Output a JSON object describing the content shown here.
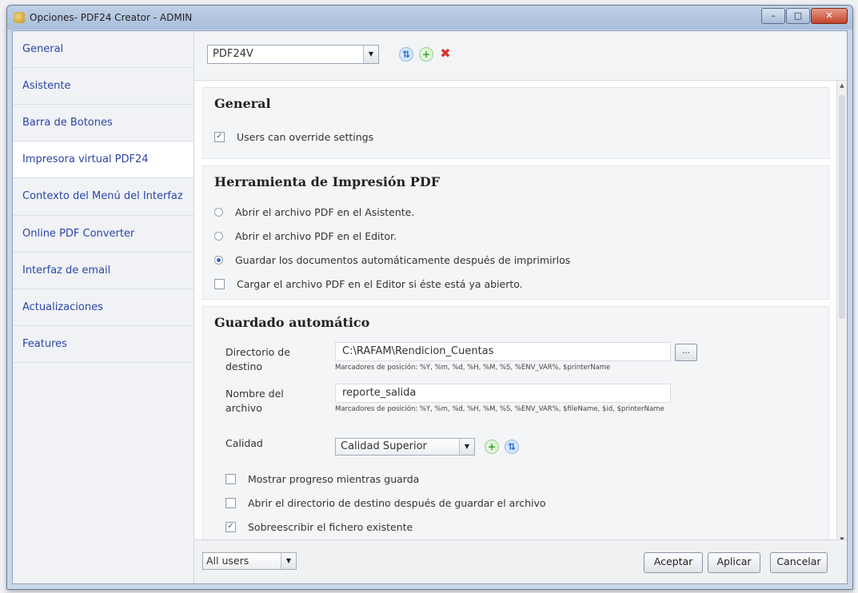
{
  "window": {
    "title": "Opciones- PDF24 Creator - ADMIN",
    "controls": [
      "–",
      "□",
      "✕"
    ]
  },
  "sidebar": {
    "items": [
      {
        "label": "General"
      },
      {
        "label": "Asistente"
      },
      {
        "label": "Barra de Botones"
      },
      {
        "label": "Impresora virtual PDF24"
      },
      {
        "label": "Contexto del Menú del Interfaz"
      },
      {
        "label": "Online PDF Converter"
      },
      {
        "label": "Interfaz de email"
      },
      {
        "label": "Actualizaciones"
      },
      {
        "label": "Features"
      }
    ],
    "active_index": 3
  },
  "toolbar": {
    "profile_value": "PDF24V"
  },
  "sections": {
    "general": {
      "title": "General",
      "users_override_label": "Users can override settings",
      "users_override_checked": true
    },
    "herramienta": {
      "title": "Herramienta de Impresión PDF",
      "options": [
        {
          "label": "Abrir el archivo PDF en el Asistente.",
          "type": "radio",
          "checked": false
        },
        {
          "label": "Abrir el archivo PDF en el Editor.",
          "type": "radio",
          "checked": false
        },
        {
          "label": "Guardar los documentos automáticamente después de imprimirlos",
          "type": "radio",
          "checked": true
        },
        {
          "label": "Cargar el archivo PDF en el Editor si éste está ya abierto.",
          "type": "checkbox",
          "checked": false
        }
      ]
    },
    "guardado": {
      "title": "Guardado automático",
      "dir_label": "Directorio de destino",
      "dir_value": "C:\\RAFAM\\Rendicion_Cuentas",
      "dir_hint": "Marcadores de posición: %Y, %m, %d, %H, %M, %S, %ENV_VAR%, $printerName",
      "browse_label": "...",
      "name_label": "Nombre del archivo",
      "name_value": "reporte_salida",
      "name_hint": "Marcadores de posición: %Y, %m, %d, %H, %M, %S, %ENV_VAR%, $fileName, $id, $printerName",
      "quality_label": "Calidad",
      "quality_value": "Calidad Superior",
      "checks": [
        {
          "label": "Mostrar progreso mientras guarda",
          "checked": false
        },
        {
          "label": "Abrir el directorio de destino después de guardar el archivo",
          "checked": false
        },
        {
          "label": "Sobreescribir el fichero existente",
          "checked": true
        }
      ]
    }
  },
  "footer": {
    "scope_value": "All users",
    "accept_label": "Aceptar",
    "apply_label": "Aplicar",
    "cancel_label": "Cancelar"
  }
}
